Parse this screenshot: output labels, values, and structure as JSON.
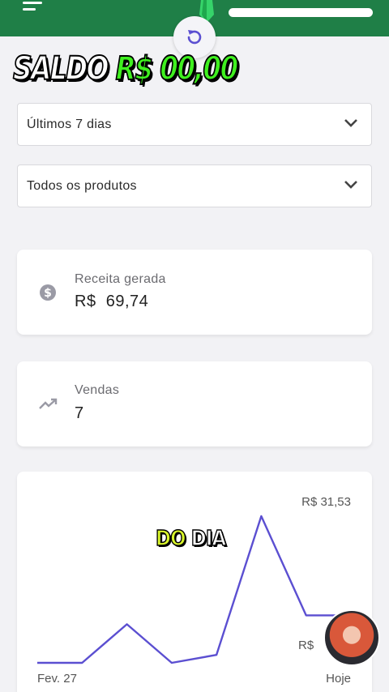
{
  "header": {
    "refresh_icon": "refresh-icon",
    "menu_icon": "menu-icon",
    "gem_icon": "gem-icon"
  },
  "overlay": {
    "balance_label": "SALDO",
    "balance_value": "R$ 00,00",
    "caption_a": "DO",
    "caption_b": "DIA"
  },
  "filters": {
    "period": "Últimos 7 dias",
    "product": "Todos os produtos"
  },
  "cards": {
    "revenue": {
      "label": "Receita gerada",
      "currency": "R$",
      "value": "69,74",
      "icon": "dollar-icon"
    },
    "sales": {
      "label": "Vendas",
      "value": "7",
      "icon": "trending-up-icon"
    }
  },
  "chart_data": {
    "type": "line",
    "x": [
      "Fev. 27",
      "",
      "",
      "",
      "",
      "",
      "",
      "Hoje"
    ],
    "values": [
      0,
      0,
      8.3,
      0,
      1.7,
      31.53,
      10.2,
      10.2
    ],
    "peak_label": "R$  31,53",
    "low_label": "R$",
    "x_start_label": "Fev. 27",
    "x_end_label": "Hoje",
    "ylim": [
      0,
      31.53
    ],
    "line_color": "#5b4fd1"
  },
  "colors": {
    "header": "#1f7f47",
    "accent": "#5b4fd1"
  }
}
